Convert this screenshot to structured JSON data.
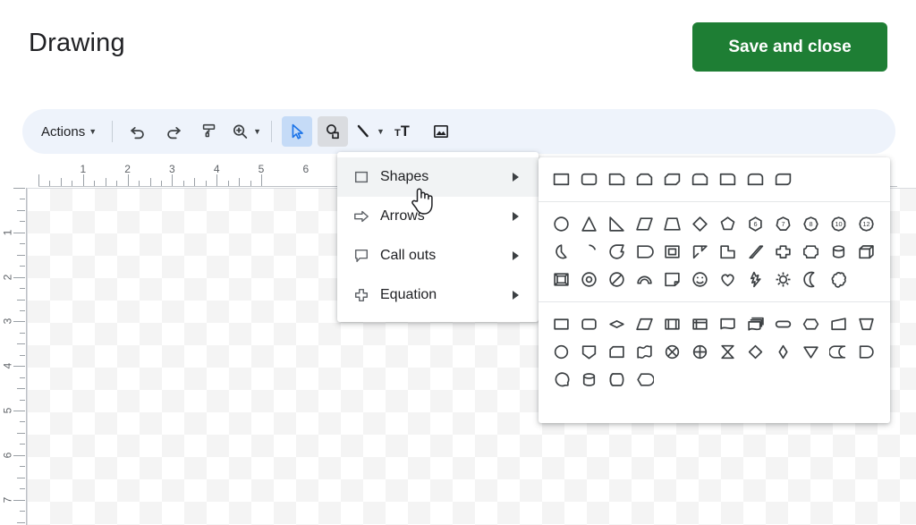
{
  "header": {
    "title": "Drawing",
    "save_label": "Save and close",
    "save_color": "#1e7e34"
  },
  "toolbar": {
    "actions_label": "Actions",
    "items": [
      {
        "name": "actions-menu",
        "label": "Actions",
        "icon": "caret-down",
        "state": "normal"
      },
      {
        "name": "undo-button",
        "label": "Undo",
        "icon": "undo-icon",
        "state": "normal"
      },
      {
        "name": "redo-button",
        "label": "Redo",
        "icon": "redo-icon",
        "state": "normal"
      },
      {
        "name": "paint-format-button",
        "label": "Paint format",
        "icon": "paint-roller-icon",
        "state": "normal"
      },
      {
        "name": "zoom-button",
        "label": "Zoom",
        "icon": "magnifier-plus-icon",
        "state": "normal"
      },
      {
        "name": "select-tool",
        "label": "Select",
        "icon": "cursor-arrow-icon",
        "state": "active-blue"
      },
      {
        "name": "shape-tool",
        "label": "Shape",
        "icon": "shapes-icon",
        "state": "active-gray"
      },
      {
        "name": "line-tool",
        "label": "Line",
        "icon": "line-icon",
        "state": "normal"
      },
      {
        "name": "text-box-tool",
        "label": "Text box",
        "icon": "text-box-icon",
        "state": "normal"
      },
      {
        "name": "image-tool",
        "label": "Image",
        "icon": "image-icon",
        "state": "normal"
      }
    ]
  },
  "shape_menu": {
    "items": [
      {
        "label": "Shapes",
        "icon": "square-icon",
        "highlighted": true
      },
      {
        "label": "Arrows",
        "icon": "arrow-icon",
        "highlighted": false
      },
      {
        "label": "Call outs",
        "icon": "callout-icon",
        "highlighted": false
      },
      {
        "label": "Equation",
        "icon": "plus-cross-icon",
        "highlighted": false
      }
    ]
  },
  "shapes_palette": {
    "sections": [
      {
        "name": "text-boxes",
        "rows": [
          [
            "rectangle",
            "round-rectangle",
            "snip-single-corner-rectangle",
            "snip-same-side-corner-rectangle",
            "snip-diagonal-corner-rectangle",
            "snip-round-single-corner-rectangle",
            "round-single-corner-rectangle",
            "round-same-side-corner-rectangle",
            "round-diagonal-corner-rectangle"
          ]
        ]
      },
      {
        "name": "basic-shapes",
        "rows": [
          [
            "ellipse",
            "triangle",
            "right-triangle",
            "parallelogram",
            "trapezoid",
            "diamond",
            "pentagon",
            "hexagon-6",
            "heptagon-7",
            "octagon-8",
            "decagon-10",
            "dodecagon-12"
          ],
          [
            "pie",
            "arc",
            "teardrop",
            "half-frame-round",
            "frame",
            "bent-corner",
            "l-shape",
            "diagonal-stripe",
            "cross",
            "plaque",
            "cylinder",
            "cube"
          ],
          [
            "bevel",
            "donut",
            "no-symbol",
            "block-arc",
            "folded-corner",
            "smiley-face",
            "heart",
            "lightning-bolt",
            "sun",
            "moon",
            "cloud"
          ]
        ]
      },
      {
        "name": "flowchart-shapes",
        "rows": [
          [
            "flowchart-process",
            "flowchart-alternate-process",
            "flowchart-decision",
            "flowchart-data",
            "flowchart-predefined-process",
            "flowchart-internal-storage",
            "flowchart-document",
            "flowchart-multidocument",
            "flowchart-terminator",
            "flowchart-preparation",
            "flowchart-manual-input",
            "flowchart-manual-operation"
          ],
          [
            "flowchart-connector",
            "flowchart-off-page-connector",
            "flowchart-card",
            "flowchart-punched-tape",
            "flowchart-summing-junction",
            "flowchart-or",
            "flowchart-collate",
            "flowchart-sort",
            "flowchart-extract",
            "flowchart-merge",
            "flowchart-stored-data",
            "flowchart-delay"
          ],
          [
            "flowchart-sequential-access-storage",
            "flowchart-magnetic-disk",
            "flowchart-direct-access-storage",
            "flowchart-display"
          ]
        ]
      }
    ],
    "polygon_labels": {
      "hexagon-6": "6",
      "heptagon-7": "7",
      "octagon-8": "8",
      "decagon-10": "10",
      "dodecagon-12": "12"
    }
  },
  "ruler": {
    "horizontal_numbers": [
      "1",
      "2",
      "3",
      "4",
      "5",
      "6"
    ],
    "vertical_numbers": [
      "1",
      "2",
      "3",
      "4",
      "5",
      "6",
      "7"
    ],
    "unit": "inches"
  },
  "canvas": {
    "background": "transparent-checkerboard"
  },
  "cursor": {
    "type": "pointing-hand"
  }
}
